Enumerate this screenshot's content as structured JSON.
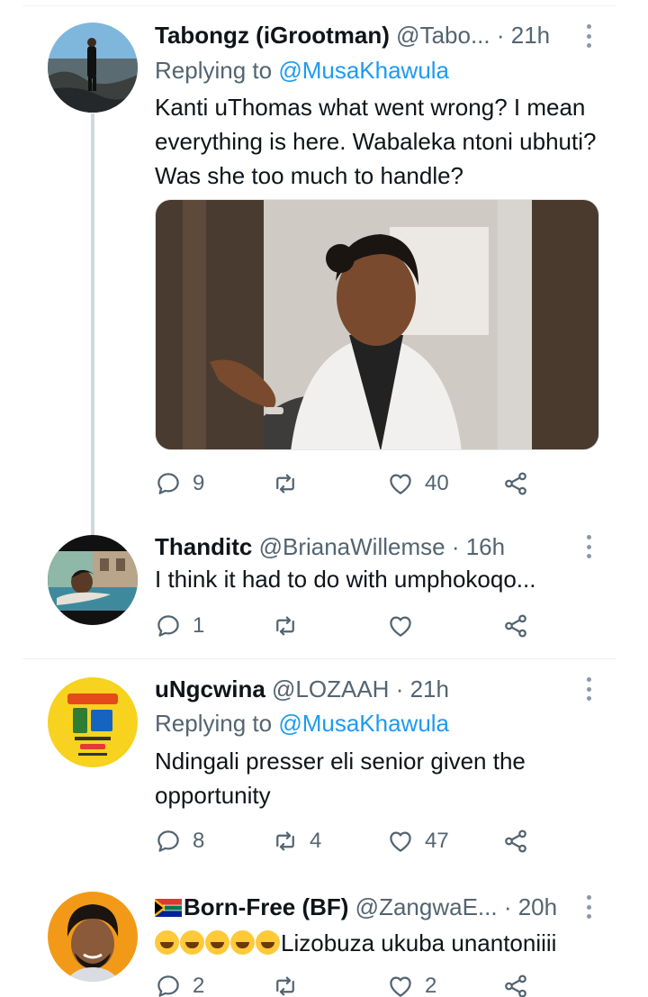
{
  "tweets": [
    {
      "name": "Tabongz (iGrootman)",
      "handle": "@Tabo...",
      "time": "21h",
      "replying_prefix": "Replying to",
      "replying_to": "@MusaKhawula",
      "text": "Kanti uThomas what went wrong? I mean everything is here. Wabaleka ntoni ubhuti? Was she too much to handle?",
      "replies": "9",
      "retweets": "",
      "likes": "40"
    },
    {
      "name": "Thanditc",
      "handle": "@BrianaWillemse",
      "time": "16h",
      "text": "I think it had to do with umphokoqo...",
      "replies": "1",
      "retweets": "",
      "likes": ""
    },
    {
      "name": "uNgcwina",
      "handle": "@LOZAAH",
      "time": "21h",
      "replying_prefix": "Replying to",
      "replying_to": "@MusaKhawula",
      "text": "Ndingali presser eli senior given the opportunity",
      "replies": "8",
      "retweets": "4",
      "likes": "47"
    },
    {
      "name": "Born-Free (BF)",
      "handle": "@ZangwaE...",
      "time": "20h",
      "text": "Lizobuza ukuba unantoniiii",
      "replies": "2",
      "retweets": "",
      "likes": "2"
    }
  ],
  "separator": "·",
  "icons": {
    "reply": "reply-icon",
    "retweet": "retweet-icon",
    "like": "heart-icon",
    "share": "share-icon",
    "more": "more-icon",
    "flag": "south-africa-flag-icon",
    "emoji": "rolling-laughing-emoji"
  },
  "colors": {
    "text": "#0f1419",
    "secondary": "#536471",
    "link": "#1d9bf0",
    "thread_line": "#cfd9de"
  }
}
